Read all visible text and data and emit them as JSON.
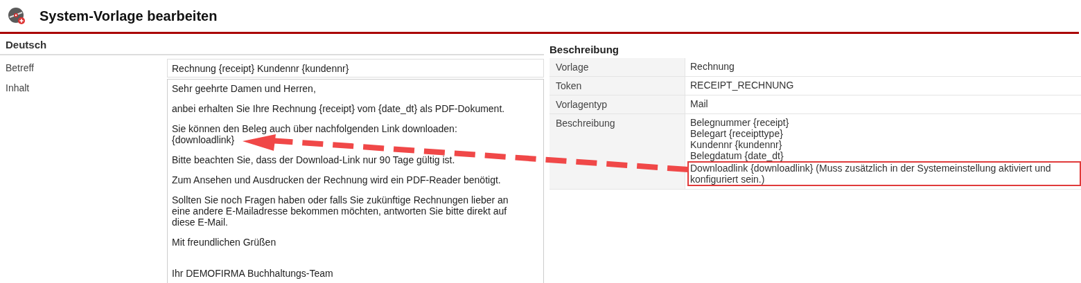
{
  "window": {
    "title": "System-Vorlage bearbeiten"
  },
  "editor": {
    "section_title": "Deutsch",
    "subject": {
      "label": "Betreff",
      "value": "Rechnung {receipt} Kundennr {kundennr}"
    },
    "body": {
      "label": "Inhalt",
      "paragraphs": [
        {
          "lines": [
            "Sehr geehrte Damen und Herren,"
          ],
          "extra_space": false
        },
        {
          "lines": [
            "anbei erhalten Sie Ihre Rechnung {receipt} vom {date_dt} als PDF-Dokument."
          ],
          "extra_space": false
        },
        {
          "lines": [
            "Sie können den Beleg auch über nachfolgenden Link downloaden:",
            "{downloadlink}"
          ],
          "extra_space": false
        },
        {
          "lines": [
            "Bitte beachten Sie, dass der Download-Link nur 90 Tage gültig ist."
          ],
          "extra_space": false
        },
        {
          "lines": [
            "Zum Ansehen und Ausdrucken der Rechnung wird ein PDF-Reader benötigt."
          ],
          "extra_space": false
        },
        {
          "lines": [
            "Sollten Sie noch Fragen haben oder falls Sie zukünftige Rechnungen lieber an",
            "eine andere E-Mailadresse bekommen möchten, antworten Sie bitte direkt auf",
            "diese E-Mail."
          ],
          "extra_space": false
        },
        {
          "lines": [
            "Mit freundlichen Grüßen"
          ],
          "extra_space": false
        },
        {
          "lines": [
            "Ihr DEMOFIRMA Buchhaltungs-Team"
          ],
          "extra_space": true
        }
      ]
    }
  },
  "description": {
    "title": "Beschreibung",
    "rows": [
      {
        "label": "Vorlage",
        "lines": [
          {
            "text": "Rechnung",
            "highlighted": false
          }
        ]
      },
      {
        "label": "Token",
        "lines": [
          {
            "text": "RECEIPT_RECHNUNG",
            "highlighted": false
          }
        ]
      },
      {
        "label": "Vorlagentyp",
        "lines": [
          {
            "text": "Mail",
            "highlighted": false
          }
        ]
      },
      {
        "label": "Beschreibung",
        "lines": [
          {
            "text": "Belegnummer {receipt}",
            "highlighted": false
          },
          {
            "text": "Belegart {receipttype}",
            "highlighted": false
          },
          {
            "text": "Kundennr {kundennr}",
            "highlighted": false
          },
          {
            "text": "Belegdatum {date_dt}",
            "highlighted": false
          },
          {
            "text": "Downloadlink {downloadlink} (Muss zusätzlich in der Systemeinstellung aktiviert und konfiguriert sein.)",
            "highlighted": true
          }
        ]
      }
    ]
  }
}
